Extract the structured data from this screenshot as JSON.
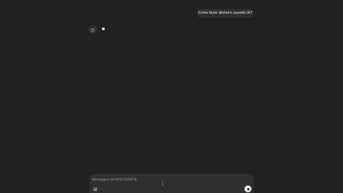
{
  "conversation": {
    "user_message": "Como fazer dinheiro usando IA?",
    "assistant_avatar_icon": "assistant-logo-icon",
    "assistant_state_icon": "thinking-dot-icon"
  },
  "composer": {
    "placeholder": "Mensagem IA INTELIGENTE",
    "value": "",
    "attach_icon": "paperclip-icon",
    "stop_icon": "stop-icon"
  },
  "colors": {
    "background": "#212121",
    "bubble": "#2f2f2f",
    "text": "#ececec",
    "muted": "#9b9b9b"
  }
}
